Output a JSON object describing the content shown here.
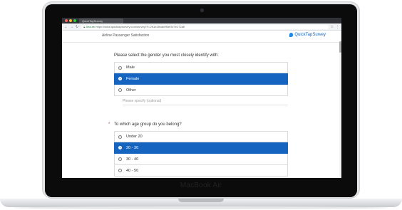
{
  "device": {
    "brand": "MacBook Air"
  },
  "browser": {
    "tab_title": "QuickTapSurvey",
    "secure_label": "Secure",
    "url": "https://www.quicktapsurvey.com/survey/?t=2b1e45cab8f0ef3c7e172a6"
  },
  "app": {
    "title": "Airline Passenger Satisfaction",
    "logo_text": "QuickTapSurvey"
  },
  "q1": {
    "text": "Please select the gender you most closely identify with:",
    "options": [
      "Male",
      "Female",
      "Other"
    ],
    "selected": "Female",
    "specify_placeholder": "Please specify (optional)"
  },
  "q2": {
    "required_marker": "*",
    "text": "To which age group do you belong?",
    "options": [
      "Under 20",
      "20 - 30",
      "30 - 40",
      "40 - 50"
    ],
    "selected": "20 - 30"
  },
  "colors": {
    "accent": "#1565c0",
    "required": "#d32f2f"
  }
}
